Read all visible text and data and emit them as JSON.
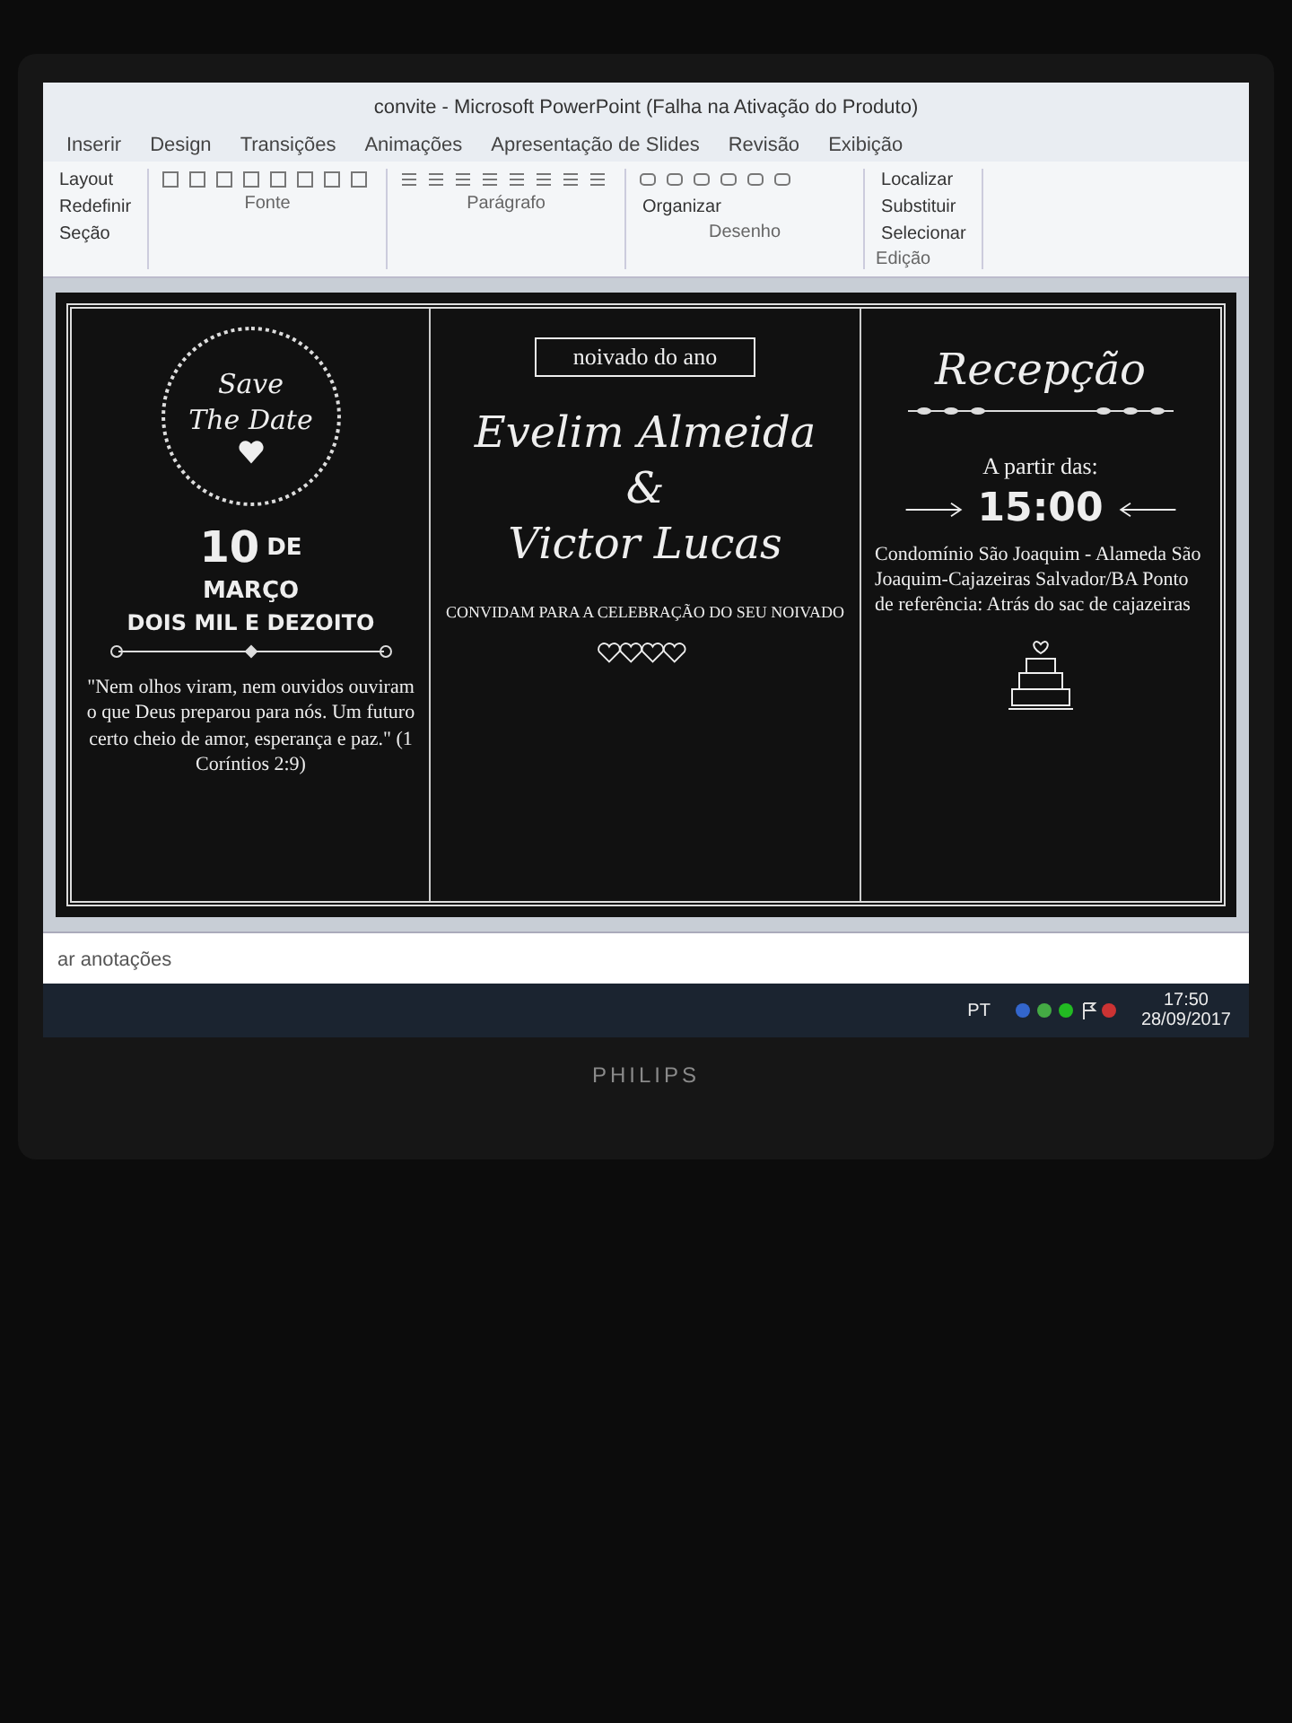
{
  "window": {
    "title": "convite - Microsoft PowerPoint (Falha na Ativação do Produto)"
  },
  "ribbon": {
    "tabs": [
      {
        "label": "Inserir",
        "selected": false
      },
      {
        "label": "Design",
        "selected": false
      },
      {
        "label": "Transições",
        "selected": false
      },
      {
        "label": "Animações",
        "selected": false
      },
      {
        "label": "Apresentação de Slides",
        "selected": false
      },
      {
        "label": "Revisão",
        "selected": false
      },
      {
        "label": "Exibição",
        "selected": false
      }
    ],
    "slide_commands": [
      "Layout",
      "Redefinir",
      "Seção"
    ],
    "group_labels": [
      "Fonte",
      "Parágrafo",
      "Desenho"
    ],
    "arrange": "Organizar",
    "editing": [
      "Localizar",
      "Substituir",
      "Selecionar"
    ],
    "editing_label": "Edição"
  },
  "slide": {
    "save_the_date": [
      "Save",
      "The Date"
    ],
    "date": {
      "day": "10",
      "de": "DE",
      "month": "MARÇO",
      "year": "DOIS MIL E DEZOITO"
    },
    "verse": "\"Nem olhos viram, nem ouvidos ouviram o que Deus preparou para nós. Um futuro certo cheio de amor, esperança e paz.\" (1 Coríntios 2:9)",
    "banner": "noivado do ano",
    "names": [
      "Evelim Almeida",
      "&",
      "Victor Lucas"
    ],
    "invite": "CONVIDAM PARA A CELEBRAÇÃO DO SEU NOIVADO",
    "reception": "Recepção",
    "from": "A partir das:",
    "time": "15:00",
    "address": "Condomínio São Joaquim - Alameda São Joaquim-Cajazeiras Salvador/BA Ponto de referência: Atrás do sac de cajazeiras"
  },
  "notes": "ar anotações",
  "taskbar": {
    "language": "PT",
    "time": "17:50",
    "date": "28/09/2017"
  },
  "monitor": {
    "brand": "PHILIPS"
  }
}
